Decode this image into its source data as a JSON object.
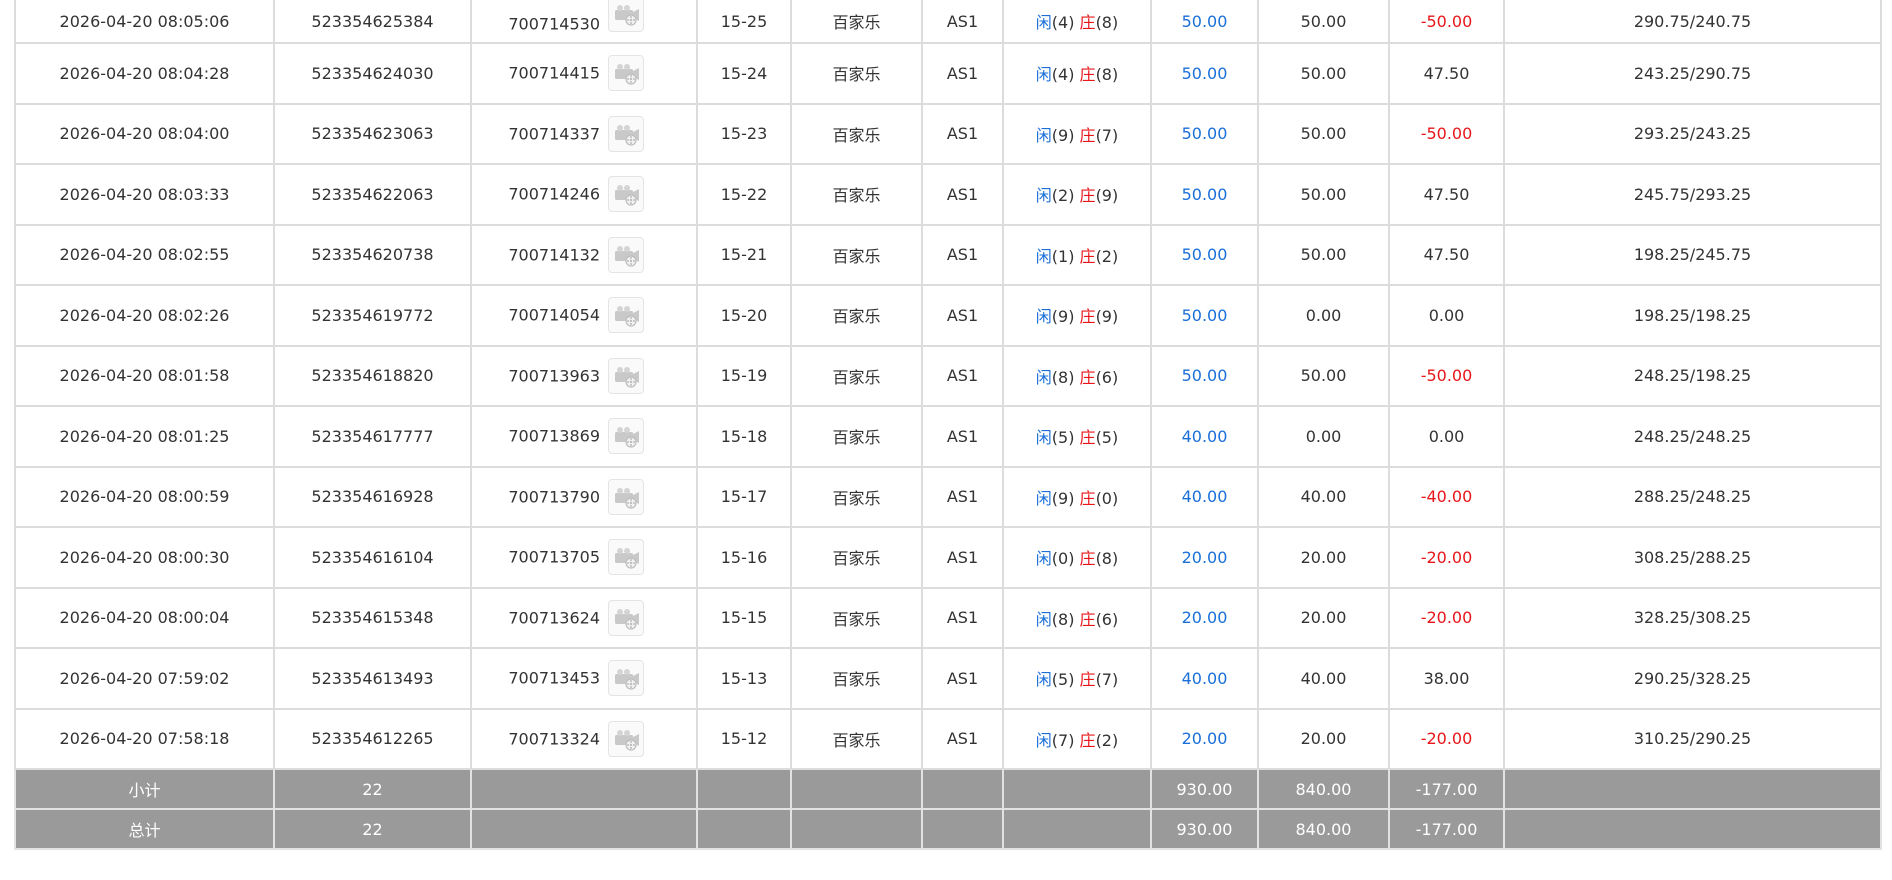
{
  "icons": {
    "video": "film-camera-icon"
  },
  "colors": {
    "player": "#1a6fd8",
    "banker": "#e8161a",
    "negative": "#e8161a",
    "summary_bg": "#9a9a9a"
  },
  "rows": [
    {
      "time": "2026-04-20 08:05:06",
      "bet_no": "523354625384",
      "game_no": "700714530",
      "shoe": "15-25",
      "game": "百家乐",
      "table": "AS1",
      "player_label": "闲",
      "player_pts": "(4)",
      "banker_label": "庄",
      "banker_pts": "(8)",
      "bet": "50.00",
      "valid": "50.00",
      "win": "-50.00",
      "balance": "290.75/240.75"
    },
    {
      "time": "2026-04-20 08:04:28",
      "bet_no": "523354624030",
      "game_no": "700714415",
      "shoe": "15-24",
      "game": "百家乐",
      "table": "AS1",
      "player_label": "闲",
      "player_pts": "(4)",
      "banker_label": "庄",
      "banker_pts": "(8)",
      "bet": "50.00",
      "valid": "50.00",
      "win": "47.50",
      "balance": "243.25/290.75"
    },
    {
      "time": "2026-04-20 08:04:00",
      "bet_no": "523354623063",
      "game_no": "700714337",
      "shoe": "15-23",
      "game": "百家乐",
      "table": "AS1",
      "player_label": "闲",
      "player_pts": "(9)",
      "banker_label": "庄",
      "banker_pts": "(7)",
      "bet": "50.00",
      "valid": "50.00",
      "win": "-50.00",
      "balance": "293.25/243.25"
    },
    {
      "time": "2026-04-20 08:03:33",
      "bet_no": "523354622063",
      "game_no": "700714246",
      "shoe": "15-22",
      "game": "百家乐",
      "table": "AS1",
      "player_label": "闲",
      "player_pts": "(2)",
      "banker_label": "庄",
      "banker_pts": "(9)",
      "bet": "50.00",
      "valid": "50.00",
      "win": "47.50",
      "balance": "245.75/293.25"
    },
    {
      "time": "2026-04-20 08:02:55",
      "bet_no": "523354620738",
      "game_no": "700714132",
      "shoe": "15-21",
      "game": "百家乐",
      "table": "AS1",
      "player_label": "闲",
      "player_pts": "(1)",
      "banker_label": "庄",
      "banker_pts": "(2)",
      "bet": "50.00",
      "valid": "50.00",
      "win": "47.50",
      "balance": "198.25/245.75"
    },
    {
      "time": "2026-04-20 08:02:26",
      "bet_no": "523354619772",
      "game_no": "700714054",
      "shoe": "15-20",
      "game": "百家乐",
      "table": "AS1",
      "player_label": "闲",
      "player_pts": "(9)",
      "banker_label": "庄",
      "banker_pts": "(9)",
      "bet": "50.00",
      "valid": "0.00",
      "win": "0.00",
      "balance": "198.25/198.25"
    },
    {
      "time": "2026-04-20 08:01:58",
      "bet_no": "523354618820",
      "game_no": "700713963",
      "shoe": "15-19",
      "game": "百家乐",
      "table": "AS1",
      "player_label": "闲",
      "player_pts": "(8)",
      "banker_label": "庄",
      "banker_pts": "(6)",
      "bet": "50.00",
      "valid": "50.00",
      "win": "-50.00",
      "balance": "248.25/198.25"
    },
    {
      "time": "2026-04-20 08:01:25",
      "bet_no": "523354617777",
      "game_no": "700713869",
      "shoe": "15-18",
      "game": "百家乐",
      "table": "AS1",
      "player_label": "闲",
      "player_pts": "(5)",
      "banker_label": "庄",
      "banker_pts": "(5)",
      "bet": "40.00",
      "valid": "0.00",
      "win": "0.00",
      "balance": "248.25/248.25"
    },
    {
      "time": "2026-04-20 08:00:59",
      "bet_no": "523354616928",
      "game_no": "700713790",
      "shoe": "15-17",
      "game": "百家乐",
      "table": "AS1",
      "player_label": "闲",
      "player_pts": "(9)",
      "banker_label": "庄",
      "banker_pts": "(0)",
      "bet": "40.00",
      "valid": "40.00",
      "win": "-40.00",
      "balance": "288.25/248.25"
    },
    {
      "time": "2026-04-20 08:00:30",
      "bet_no": "523354616104",
      "game_no": "700713705",
      "shoe": "15-16",
      "game": "百家乐",
      "table": "AS1",
      "player_label": "闲",
      "player_pts": "(0)",
      "banker_label": "庄",
      "banker_pts": "(8)",
      "bet": "20.00",
      "valid": "20.00",
      "win": "-20.00",
      "balance": "308.25/288.25"
    },
    {
      "time": "2026-04-20 08:00:04",
      "bet_no": "523354615348",
      "game_no": "700713624",
      "shoe": "15-15",
      "game": "百家乐",
      "table": "AS1",
      "player_label": "闲",
      "player_pts": "(8)",
      "banker_label": "庄",
      "banker_pts": "(6)",
      "bet": "20.00",
      "valid": "20.00",
      "win": "-20.00",
      "balance": "328.25/308.25"
    },
    {
      "time": "2026-04-20 07:59:02",
      "bet_no": "523354613493",
      "game_no": "700713453",
      "shoe": "15-13",
      "game": "百家乐",
      "table": "AS1",
      "player_label": "闲",
      "player_pts": "(5)",
      "banker_label": "庄",
      "banker_pts": "(7)",
      "bet": "40.00",
      "valid": "40.00",
      "win": "38.00",
      "balance": "290.25/328.25"
    },
    {
      "time": "2026-04-20 07:58:18",
      "bet_no": "523354612265",
      "game_no": "700713324",
      "shoe": "15-12",
      "game": "百家乐",
      "table": "AS1",
      "player_label": "闲",
      "player_pts": "(7)",
      "banker_label": "庄",
      "banker_pts": "(2)",
      "bet": "20.00",
      "valid": "20.00",
      "win": "-20.00",
      "balance": "310.25/290.25"
    }
  ],
  "subtotal": {
    "label": "小计",
    "count": "22",
    "bet": "930.00",
    "valid": "840.00",
    "win": "-177.00"
  },
  "total": {
    "label": "总计",
    "count": "22",
    "bet": "930.00",
    "valid": "840.00",
    "win": "-177.00"
  }
}
